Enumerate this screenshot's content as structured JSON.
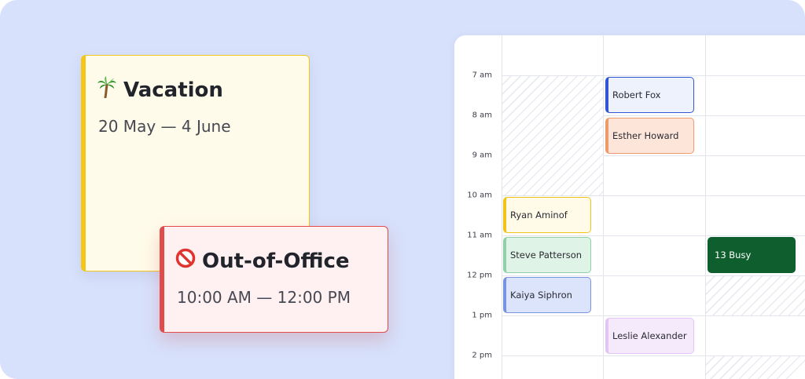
{
  "vacation_card": {
    "icon": "palm-tree-icon",
    "title": "Vacation",
    "dates": "20 May — 4 June",
    "accent": "#f5c518",
    "background": "#fffbea"
  },
  "ooo_card": {
    "icon": "prohibited-icon",
    "title": "Out-of-Office",
    "time_range": "10:00 AM — 12:00 PM",
    "accent": "#e04b4b",
    "background": "#fff0f2"
  },
  "calendar": {
    "time_labels": [
      "7 am",
      "8 am",
      "9 am",
      "10 am",
      "11 am",
      "12 pm",
      "1 pm",
      "2 pm"
    ],
    "events": [
      {
        "name": "Robert Fox",
        "color": "#3056d3",
        "fill": "#eef2fd"
      },
      {
        "name": "Esther Howard",
        "color": "#ee9a6a",
        "fill": "#fde5da"
      },
      {
        "name": "Ryan Aminof",
        "color": "#f2c21b",
        "fill": "#fffbe8"
      },
      {
        "name": "Steve Patterson",
        "color": "#8fd0a6",
        "fill": "#dff3e6"
      },
      {
        "name": "Kaiya Siphron",
        "color": "#7793e4",
        "fill": "#dbe4fb"
      },
      {
        "name": "Leslie Alexander",
        "color": "#e3c4f5",
        "fill": "#f5e9fc"
      },
      {
        "name": "13 Busy",
        "color": "#0f5e2e",
        "fill": "#0f5e2e"
      }
    ]
  }
}
